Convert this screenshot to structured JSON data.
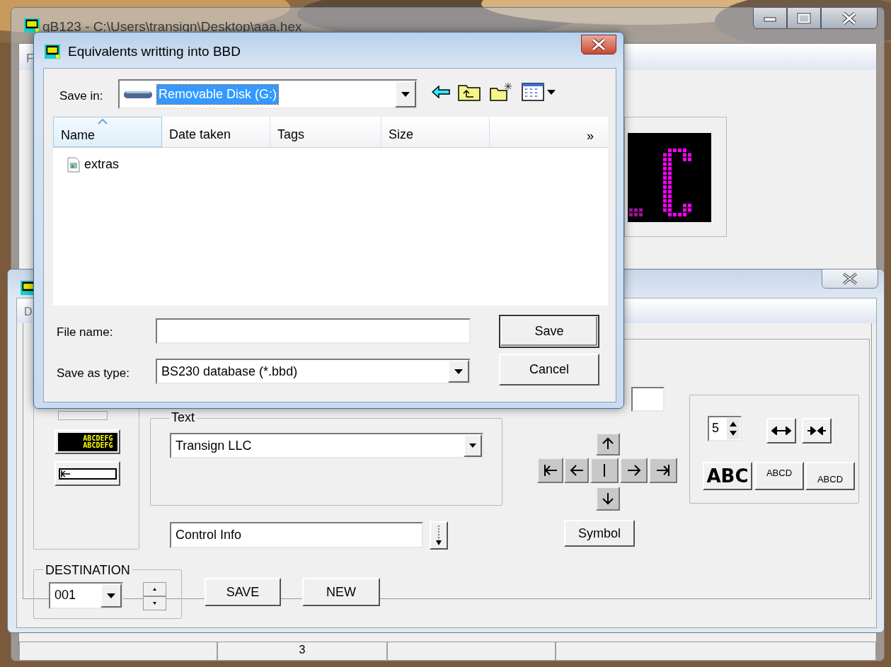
{
  "main_window": {
    "title": "qB123 - C:\\Users\\transign\\Desktop\\aaa.hex",
    "menu": [
      "F"
    ],
    "status_bar": {
      "cells": [
        {},
        {
          "text": "3"
        },
        {},
        {}
      ]
    }
  },
  "editor_window": {
    "tab_label": "D",
    "preview_lines": [
      "ABCDEFG",
      "ABCDEFG"
    ],
    "text_group": {
      "label": "Text",
      "value": "Transign LLC"
    },
    "control_info": {
      "value": "Control Info"
    },
    "symbol_button": "Symbol",
    "spacing": {
      "value": "5"
    },
    "font_buttons": [
      {
        "label": "ABC",
        "kind": "bold"
      },
      {
        "label": "ABCD",
        "kind": "raised"
      },
      {
        "label": "ABCD",
        "kind": "lowered"
      }
    ],
    "destination": {
      "label": "DESTINATION",
      "value": "001"
    },
    "actions": [
      "SAVE",
      "NEW"
    ]
  },
  "save_dialog": {
    "title": "Equivalents writting into BBD",
    "save_in": {
      "label": "Save in:",
      "value": "Removable Disk (G:)"
    },
    "columns": [
      {
        "label": "Name",
        "sorted": true
      },
      {
        "label": "Date taken",
        "sorted": false
      },
      {
        "label": "Tags",
        "sorted": false
      },
      {
        "label": "Size",
        "sorted": false
      }
    ],
    "more_columns": "»",
    "files": [
      {
        "name": "extras"
      }
    ],
    "file_name": {
      "label": "File name:"
    },
    "save_as_type": {
      "label": "Save as type:",
      "value": "BS230 database (*.bbd)"
    },
    "buttons": [
      {
        "label": "Save",
        "default": true
      },
      {
        "label": "Cancel",
        "default": false
      }
    ]
  }
}
